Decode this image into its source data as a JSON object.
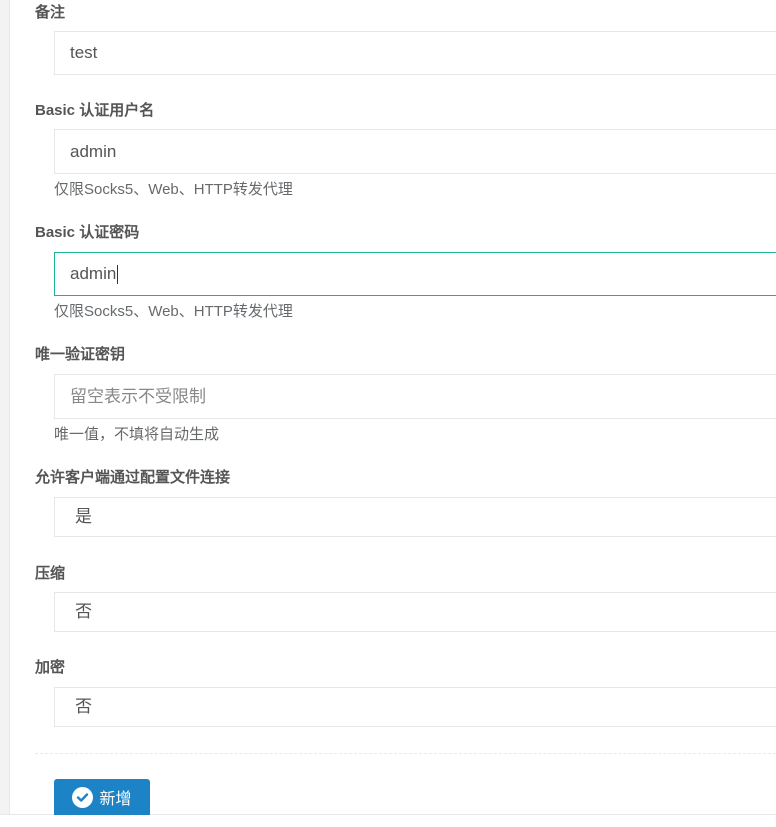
{
  "form": {
    "remark": {
      "label": "备注",
      "value": "test"
    },
    "basic_user": {
      "label": "Basic 认证用户名",
      "value": "admin",
      "help": "仅限Socks5、Web、HTTP转发代理"
    },
    "basic_pass": {
      "label": "Basic 认证密码",
      "value": "admin",
      "help": "仅限Socks5、Web、HTTP转发代理"
    },
    "vkey": {
      "label": "唯一验证密钥",
      "placeholder": "留空表示不受限制",
      "help": "唯一值，不填将自动生成"
    },
    "config_conn": {
      "label": "允许客户端通过配置文件连接",
      "value": "是"
    },
    "compress": {
      "label": "压缩",
      "value": "否"
    },
    "crypt": {
      "label": "加密",
      "value": "否"
    },
    "submit": {
      "label": "新增",
      "icon": "check-circle-icon"
    }
  },
  "colors": {
    "focus_border": "#1ab394",
    "button": "#1c84c6"
  }
}
